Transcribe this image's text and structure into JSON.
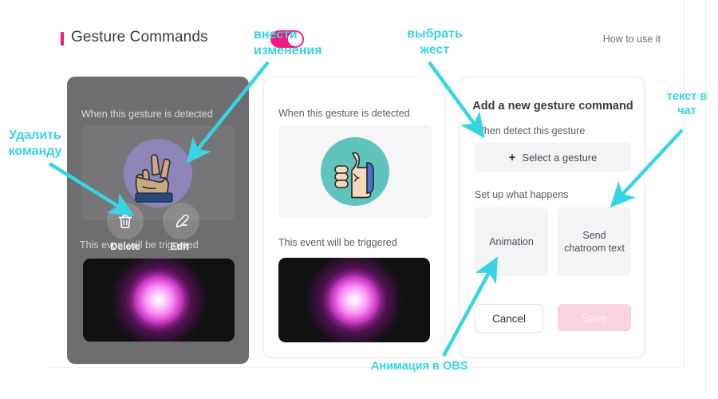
{
  "header": {
    "title": "Gesture Commands",
    "toggle_on": true,
    "help_link": "How to use it"
  },
  "colors": {
    "accent_pink": "#f5197e",
    "annotation_cyan": "#37d5e3",
    "save_disabled": "#fbd2e2",
    "card_hover_bg": "#6e6e70"
  },
  "cards": [
    {
      "state": "hovered",
      "detect_label": "When this gesture is detected",
      "gesture_icon": "victory-hand-gesture",
      "gesture_bg": "#8d85b9",
      "trigger_label": "This event will be triggered",
      "actions": [
        {
          "icon": "trash-icon",
          "label": "Delete"
        },
        {
          "icon": "pencil-icon",
          "label": "Edit"
        }
      ],
      "preview": "particle-burst-animation"
    },
    {
      "state": "normal",
      "detect_label": "When this gesture is detected",
      "gesture_icon": "thumbs-up-gesture",
      "gesture_bg": "#5ec4bd",
      "trigger_label": "This event will be triggered",
      "preview": "particle-burst-animation"
    }
  ],
  "add_panel": {
    "title": "Add a new gesture command",
    "detect_label": "When detect this gesture",
    "select_gesture_button": "Select a gesture",
    "select_gesture_icon": "plus-icon",
    "setup_label": "Set up what happens",
    "options": [
      {
        "label": "Animation"
      },
      {
        "label": "Send chatroom text"
      }
    ],
    "cancel_label": "Cancel",
    "save_label": "Save",
    "save_enabled": false
  },
  "annotations": [
    {
      "id": "toggle-note",
      "text": "внести изменения"
    },
    {
      "id": "select-gesture-note",
      "text": "выбрать жест"
    },
    {
      "id": "delete-note",
      "text": "Удалить команду"
    },
    {
      "id": "chat-text-note",
      "text": "текст в чат"
    },
    {
      "id": "animation-note",
      "text": "Анимация в OBS"
    }
  ]
}
